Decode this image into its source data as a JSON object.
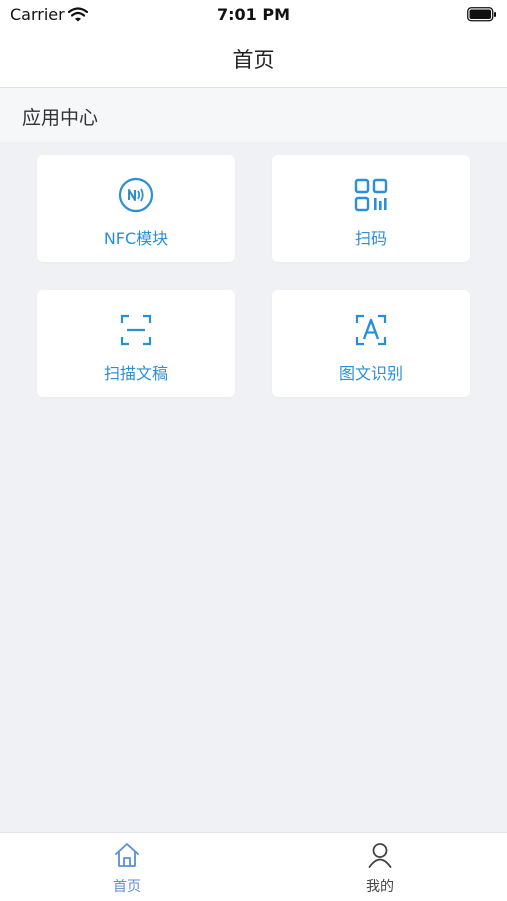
{
  "status_bar": {
    "carrier": "Carrier",
    "time": "7:01 PM"
  },
  "nav": {
    "title": "首页"
  },
  "section": {
    "title": "应用中心"
  },
  "apps": [
    {
      "label": "NFC模块",
      "icon": "nfc-icon"
    },
    {
      "label": "扫码",
      "icon": "qr-code-icon"
    },
    {
      "label": "扫描文稿",
      "icon": "scan-document-icon"
    },
    {
      "label": "图文识别",
      "icon": "text-recognition-icon"
    }
  ],
  "tabs": [
    {
      "label": "首页",
      "icon": "home-icon",
      "active": true
    },
    {
      "label": "我的",
      "icon": "user-icon",
      "active": false
    }
  ],
  "colors": {
    "accent": "#2a8fd9",
    "background": "#eff1f4",
    "tab_active": "#5b8fd6",
    "tab_inactive": "#444444"
  }
}
